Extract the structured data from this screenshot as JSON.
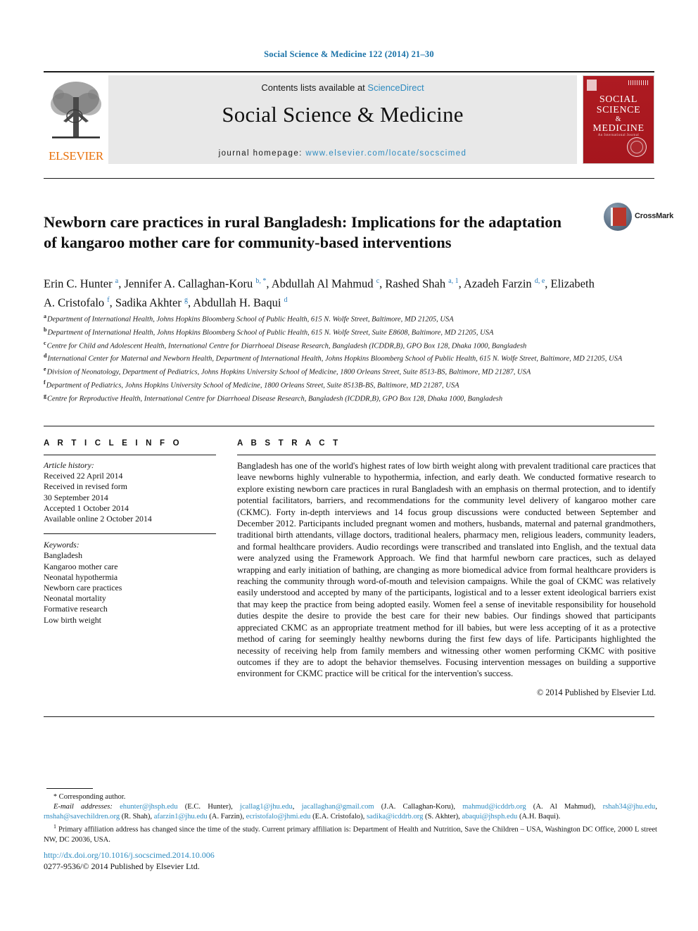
{
  "running_head": "Social Science & Medicine 122 (2014) 21–30",
  "masthead": {
    "publisher_logo_label": "ELSEVIER",
    "contents_prefix": "Contents lists available at ",
    "contents_link": "ScienceDirect",
    "journal_title": "Social Science & Medicine",
    "homepage_prefix": "journal homepage: ",
    "homepage_link": "www.elsevier.com/locate/socscimed",
    "cover": {
      "line1": "SOCIAL",
      "line2": "SCIENCE",
      "amp": "&",
      "line3": "MEDICINE",
      "subtitle": "An International Journal"
    }
  },
  "crossmark": {
    "label": "CrossMark"
  },
  "article": {
    "title": "Newborn care practices in rural Bangladesh: Implications for the adaptation of kangaroo mother care for community-based interventions",
    "authors_html": "Erin C. Hunter <sup class=\"aff-marker\">a</sup>, Jennifer A. Callaghan-Koru <sup class=\"aff-marker\">b, *</sup>, Abdullah Al Mahmud <sup class=\"aff-marker\">c</sup>, Rashed Shah <sup class=\"aff-marker\">a, 1</sup>, Azadeh Farzin <sup class=\"aff-marker\">d, e</sup>, Elizabeth A. Cristofalo <sup class=\"aff-marker\">f</sup>, Sadika Akhter <sup class=\"aff-marker\">g</sup>, Abdullah H. Baqui <sup class=\"aff-marker\">d</sup>",
    "affiliations": [
      {
        "label": "a",
        "text": "Department of International Health, Johns Hopkins Bloomberg School of Public Health, 615 N. Wolfe Street, Baltimore, MD 21205, USA"
      },
      {
        "label": "b",
        "text": "Department of International Health, Johns Hopkins Bloomberg School of Public Health, 615 N. Wolfe Street, Suite E8608, Baltimore, MD 21205, USA"
      },
      {
        "label": "c",
        "text": "Centre for Child and Adolescent Health, International Centre for Diarrhoeal Disease Research, Bangladesh (ICDDR,B), GPO Box 128, Dhaka 1000, Bangladesh"
      },
      {
        "label": "d",
        "text": "International Center for Maternal and Newborn Health, Department of International Health, Johns Hopkins Bloomberg School of Public Health, 615 N. Wolfe Street, Baltimore, MD 21205, USA"
      },
      {
        "label": "e",
        "text": "Division of Neonatology, Department of Pediatrics, Johns Hopkins University School of Medicine, 1800 Orleans Street, Suite 8513-BS, Baltimore, MD 21287, USA"
      },
      {
        "label": "f",
        "text": "Department of Pediatrics, Johns Hopkins University School of Medicine, 1800 Orleans Street, Suite 8513B-BS, Baltimore, MD 21287, USA"
      },
      {
        "label": "g",
        "text": "Centre for Reproductive Health, International Centre for Diarrhoeal Disease Research, Bangladesh (ICDDR,B), GPO Box 128, Dhaka 1000, Bangladesh"
      }
    ]
  },
  "article_info": {
    "heading": "A R T I C L E   I N F O",
    "history_label": "Article history:",
    "history": [
      "Received 22 April 2014",
      "Received in revised form",
      "30 September 2014",
      "Accepted 1 October 2014",
      "Available online 2 October 2014"
    ],
    "keywords_label": "Keywords:",
    "keywords": [
      "Bangladesh",
      "Kangaroo mother care",
      "Neonatal hypothermia",
      "Newborn care practices",
      "Neonatal mortality",
      "Formative research",
      "Low birth weight"
    ]
  },
  "abstract": {
    "heading": "A B S T R A C T",
    "text": "Bangladesh has one of the world's highest rates of low birth weight along with prevalent traditional care practices that leave newborns highly vulnerable to hypothermia, infection, and early death. We conducted formative research to explore existing newborn care practices in rural Bangladesh with an emphasis on thermal protection, and to identify potential facilitators, barriers, and recommendations for the community level delivery of kangaroo mother care (CKMC). Forty in-depth interviews and 14 focus group discussions were conducted between September and December 2012. Participants included pregnant women and mothers, husbands, maternal and paternal grandmothers, traditional birth attendants, village doctors, traditional healers, pharmacy men, religious leaders, community leaders, and formal healthcare providers. Audio recordings were transcribed and translated into English, and the textual data were analyzed using the Framework Approach. We find that harmful newborn care practices, such as delayed wrapping and early initiation of bathing, are changing as more biomedical advice from formal healthcare providers is reaching the community through word-of-mouth and television campaigns. While the goal of CKMC was relatively easily understood and accepted by many of the participants, logistical and to a lesser extent ideological barriers exist that may keep the practice from being adopted easily. Women feel a sense of inevitable responsibility for household duties despite the desire to provide the best care for their new babies. Our findings showed that participants appreciated CKMC as an appropriate treatment method for ill babies, but were less accepting of it as a protective method of caring for seemingly healthy newborns during the first few days of life. Participants highlighted the necessity of receiving help from family members and witnessing other women performing CKMC with positive outcomes if they are to adopt the behavior themselves. Focusing intervention messages on building a supportive environment for CKMC practice will be critical for the intervention's success.",
    "copyright": "© 2014 Published by Elsevier Ltd."
  },
  "footnotes": {
    "corresponding_author": "Corresponding author.",
    "email_label": "E-mail addresses:",
    "emails_html": "<span class=\"mail\">ehunter@jhsph.edu</span> (E.C. Hunter), <span class=\"mail\">jcallag1@jhu.edu</span>, <span class=\"mail\">jacallaghan@gmail.com</span> (J.A. Callaghan-Koru), <span class=\"mail\">mahmud@icddrb.org</span> (A. Al Mahmud), <span class=\"mail\">rshah34@jhu.edu</span>, <span class=\"mail\">rnshah@savechildren.org</span> (R. Shah), <span class=\"mail\">afarzin1@jhu.edu</span> (A. Farzin), <span class=\"mail\">ecristofalo@jhmi.edu</span> (E.A. Cristofalo), <span class=\"mail\">sadika@icddrb.org</span> (S. Akhter), <span class=\"mail\">abaqui@jhsph.edu</span> (A.H. Baqui).",
    "note1": "Primary affiliation address has changed since the time of the study. Current primary affiliation is: Department of Health and Nutrition, Save the Children – USA, Washington DC Office, 2000 L street NW, DC 20036, USA."
  },
  "footer": {
    "doi": "http://dx.doi.org/10.1016/j.socscimed.2014.10.006",
    "issn_line": "0277-9536/© 2014 Published by Elsevier Ltd."
  },
  "colors": {
    "link": "#2e8bc0",
    "running_head": "#1a72a8",
    "elsevier_orange": "#e8700a",
    "cover_red": "#ae1b22"
  }
}
